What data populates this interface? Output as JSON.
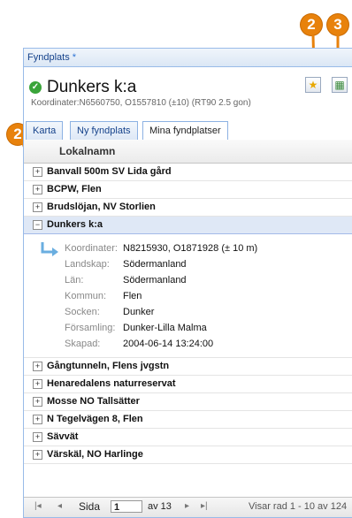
{
  "callouts": {
    "left": "2",
    "star": "2",
    "map": "3"
  },
  "panel": {
    "header_title": "Fyndplats",
    "header_star": "*",
    "title": "Dunkers k:a",
    "coords_subtitle": "Koordinater:N6560750, O1557810 (±10) (RT90 2.5 gon)"
  },
  "toolbar": {
    "star_icon": "★",
    "map_icon": "▦"
  },
  "tabs": [
    {
      "label": "Karta"
    },
    {
      "label": "Ny fyndplats"
    },
    {
      "label": "Mina fyndplatser"
    }
  ],
  "grid": {
    "column": "Lokalnamn",
    "rows_top": [
      {
        "name": "Banvall 500m SV Lida gård",
        "toggle": "+"
      },
      {
        "name": "BCPW, Flen",
        "toggle": "+"
      },
      {
        "name": "Brudslöjan, NV Storlien",
        "toggle": "+"
      }
    ],
    "selected": {
      "name": "Dunkers k:a",
      "toggle": "−"
    },
    "details": [
      {
        "label": "Koordinater:",
        "value": "N8215930, O1871928 (± 10 m)"
      },
      {
        "label": "Landskap:",
        "value": "Södermanland"
      },
      {
        "label": "Län:",
        "value": "Södermanland"
      },
      {
        "label": "Kommun:",
        "value": "Flen"
      },
      {
        "label": "Socken:",
        "value": "Dunker"
      },
      {
        "label": "Församling:",
        "value": "Dunker-Lilla Malma"
      },
      {
        "label": "Skapad:",
        "value": "2004-06-14 13:24:00"
      }
    ],
    "rows_bottom": [
      {
        "name": "Gångtunneln, Flens jvgstn",
        "toggle": "+"
      },
      {
        "name": "Henaredalens naturreservat",
        "toggle": "+"
      },
      {
        "name": "Mosse NO Tallsätter",
        "toggle": "+"
      },
      {
        "name": "N Tegelvägen 8, Flen",
        "toggle": "+"
      },
      {
        "name": "Sävvät",
        "toggle": "+"
      },
      {
        "name": "Värskäl, NO Harlinge",
        "toggle": "+"
      }
    ]
  },
  "pager": {
    "first": "|◂",
    "prev": "◂",
    "page_label": "Sida",
    "page_value": "1",
    "of_label": "av 13",
    "next": "▸",
    "last": "▸|",
    "status": "Visar rad 1 - 10 av 124"
  }
}
